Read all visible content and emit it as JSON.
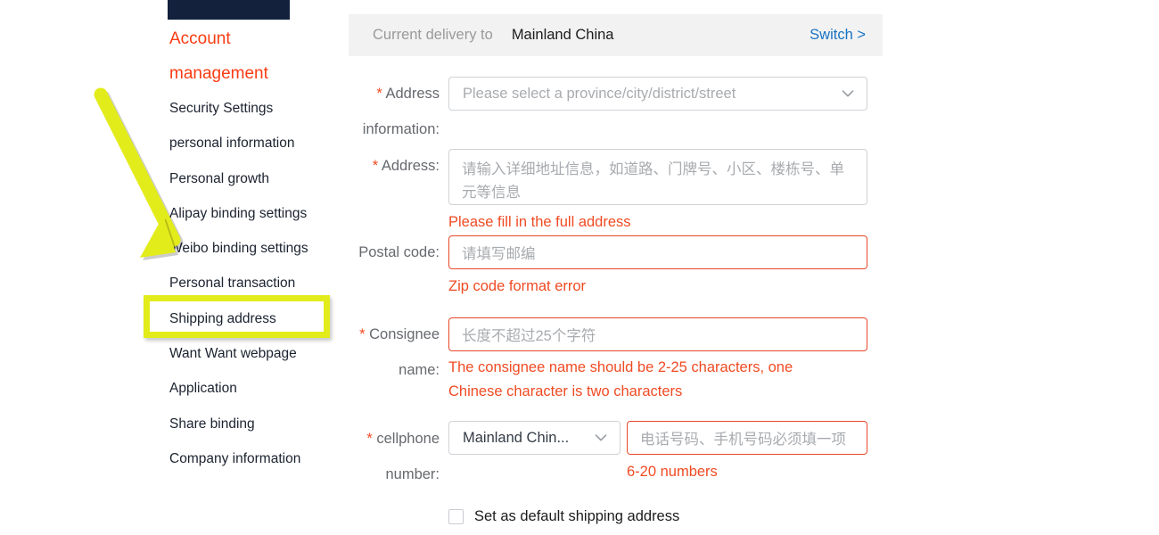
{
  "sidebar": {
    "heading_line1": "Account",
    "heading_line2": "management",
    "items": [
      {
        "label": "Security Settings"
      },
      {
        "label": "personal information"
      },
      {
        "label": "Personal growth"
      },
      {
        "label": "Alipay binding settings"
      },
      {
        "label": "Weibo binding settings"
      },
      {
        "label": "Personal transaction"
      },
      {
        "label": "Shipping address"
      },
      {
        "label": "Want Want webpage"
      },
      {
        "label": "Application"
      },
      {
        "label": "Share binding"
      },
      {
        "label": "Company information"
      }
    ]
  },
  "delivery_bar": {
    "label": "Current delivery to",
    "value": "Mainland China",
    "switch_label": "Switch >"
  },
  "form": {
    "address_info": {
      "label_line1": "Address",
      "label_line2": "information:",
      "required": "*",
      "placeholder": "Please select a province/city/district/street",
      "chevron_icon": "chevron-down-icon"
    },
    "address": {
      "label": "Address:",
      "required": "*",
      "placeholder": "请输入详细地址信息，如道路、门牌号、小区、楼栋号、单元等信息",
      "error": "Please fill in the full address"
    },
    "postal_code": {
      "label": "Postal code:",
      "placeholder": "请填写邮编",
      "error": "Zip code format error"
    },
    "consignee": {
      "label_line1": "Consignee",
      "label_line2": "name:",
      "required": "*",
      "placeholder": "长度不超过25个字符",
      "error_line1": "The consignee name should be 2-25 characters, one",
      "error_line2": "Chinese character is two characters"
    },
    "cellphone": {
      "label_line1": "cellphone",
      "label_line2": "number:",
      "required": "*",
      "country_value": "Mainland Chin...",
      "chevron_icon": "chevron-down-icon",
      "placeholder": "电话号码、手机号码必须填一项",
      "error": "6-20 numbers"
    },
    "default_checkbox": {
      "label": "Set as default shipping address",
      "checked": false
    }
  },
  "annotation": {
    "arrow_icon": "yellow-arrow-icon",
    "highlight_icon": "yellow-highlight-box",
    "color": "#e3ec1b"
  }
}
